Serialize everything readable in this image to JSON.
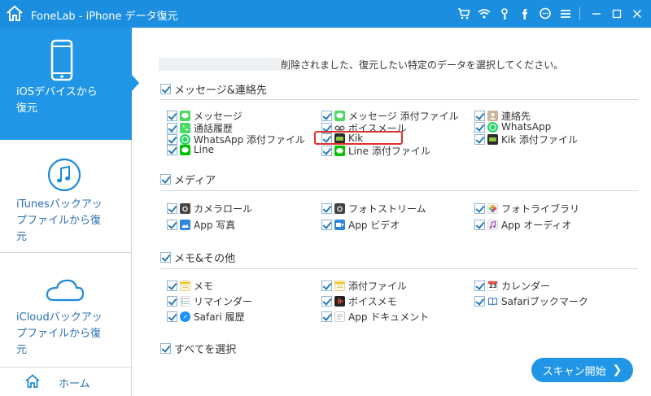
{
  "window": {
    "title": "FoneLab - iPhone データ復元"
  },
  "sidebar": {
    "items": [
      {
        "label_line1": "iOSデバイスから",
        "label_line2": "復元"
      },
      {
        "label_line1": "iTunesバックアッ",
        "label_line2": "プファイルから復",
        "label_line3": "元"
      },
      {
        "label_line1": "iCloudバックアッ",
        "label_line2": "プファイルから復",
        "label_line3": "元"
      }
    ],
    "home_label": "ホーム"
  },
  "main": {
    "intro_text": "削除されました、復元したい特定のデータを選択してください。",
    "sections": {
      "messages": {
        "header": "メッセージ&連絡先",
        "items": [
          "メッセージ",
          "メッセージ 添付ファイル",
          "連絡先",
          "通話履歴",
          "ボイスメール",
          "WhatsApp",
          "WhatsApp 添付ファイル",
          "Kik",
          "Kik 添付ファイル",
          "Line",
          "Line 添付ファイル"
        ]
      },
      "media": {
        "header": "メディア",
        "items": [
          "カメラロール",
          "フォトストリーム",
          "フォトライブラリ",
          "App 写真",
          "App ビデオ",
          "App オーディオ"
        ]
      },
      "memo": {
        "header": "メモ&その他",
        "items": [
          "メモ",
          "添付ファイル",
          "カレンダー",
          "リマインダー",
          "ボイスメモ",
          "Safariブックマーク",
          "Safari 履歴",
          "App ドキュメント"
        ]
      }
    },
    "select_all": "すべてを選択",
    "scan_button": "スキャン開始",
    "calendar_day": "23"
  },
  "colors": {
    "accent": "#2196e6",
    "titlebar": "#1c8ee0",
    "highlight": "#e0302e"
  }
}
